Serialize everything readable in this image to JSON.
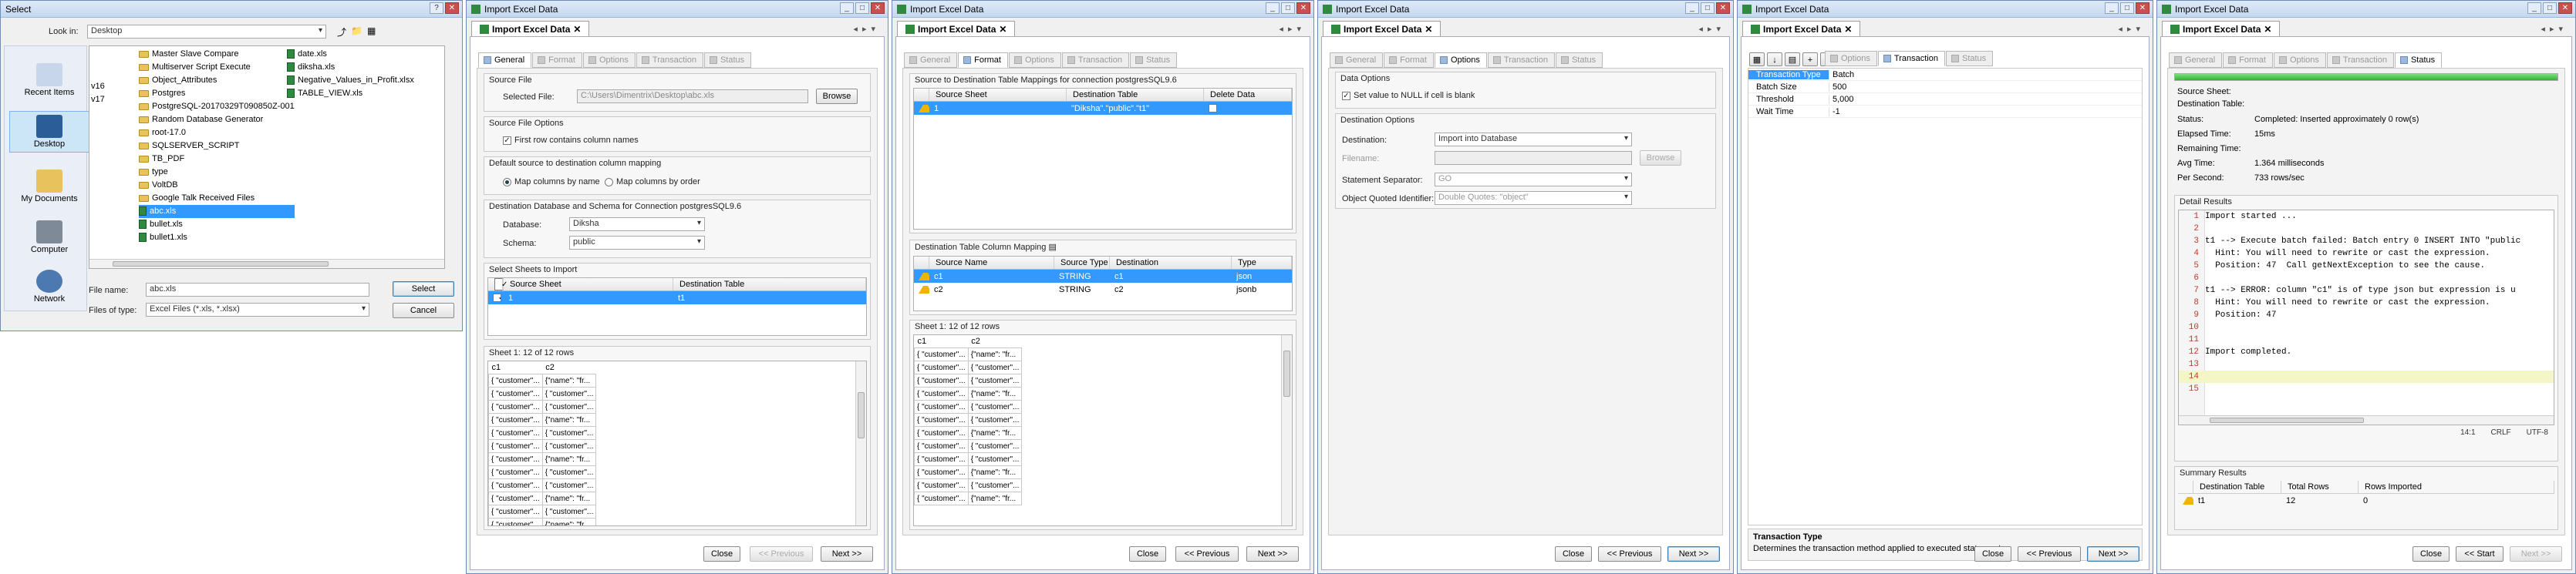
{
  "select": {
    "title": "Select",
    "look_in_label": "Look in:",
    "look_in_value": "Desktop",
    "places": [
      "Recent Items",
      "Desktop",
      "My Documents",
      "Computer",
      "Network"
    ],
    "col0": [
      "v16",
      "v17"
    ],
    "col1": [
      {
        "name": "Master Slave Compare",
        "kind": "folder"
      },
      {
        "name": "Multiserver Script Execute",
        "kind": "folder"
      },
      {
        "name": "Object_Attributes",
        "kind": "folder"
      },
      {
        "name": "Postgres",
        "kind": "folder"
      },
      {
        "name": "PostgreSQL-20170329T090850Z-001",
        "kind": "folder"
      },
      {
        "name": "Random Database Generator",
        "kind": "folder"
      },
      {
        "name": "root-17.0",
        "kind": "folder"
      },
      {
        "name": "SQLSERVER_SCRIPT",
        "kind": "folder"
      },
      {
        "name": "TB_PDF",
        "kind": "folder"
      },
      {
        "name": "type",
        "kind": "folder"
      },
      {
        "name": "VoltDB",
        "kind": "folder"
      },
      {
        "name": "Google Talk Received Files",
        "kind": "folder"
      },
      {
        "name": "abc.xls",
        "kind": "xls",
        "selected": true
      },
      {
        "name": "bullet.xls",
        "kind": "xls"
      },
      {
        "name": "bullet1.xls",
        "kind": "xls"
      }
    ],
    "col2": [
      {
        "name": "date.xls",
        "kind": "xls"
      },
      {
        "name": "diksha.xls",
        "kind": "xls"
      },
      {
        "name": "Negative_Values_in_Profit.xlsx",
        "kind": "xls"
      },
      {
        "name": "TABLE_VIEW.xls",
        "kind": "xls"
      }
    ],
    "file_name_label": "File name:",
    "file_name_value": "abc.xls",
    "files_type_label": "Files of type:",
    "files_type_value": "Excel Files (*.xls, *.xlsx)",
    "select_btn": "Select",
    "cancel_btn": "Cancel"
  },
  "common": {
    "window_title": "Import Excel Data",
    "tab_head": "Import Excel Data",
    "tabs": [
      "General",
      "Format",
      "Options",
      "Transaction",
      "Status"
    ],
    "close": "Close",
    "previous": "<< Previous",
    "next": "Next >>",
    "start": "<< Start"
  },
  "general": {
    "source_file_group": "Source File",
    "selected_file_label": "Selected File:",
    "selected_file_value": "C:\\Users\\Dimentrix\\Desktop\\abc.xls",
    "browse": "Browse",
    "source_options_group": "Source File Options",
    "first_row_label": "First row contains column names",
    "mapping_group": "Default source to destination column mapping",
    "map_by_name": "Map columns by name",
    "map_by_order": "Map columns by order",
    "dest_group": "Destination Database and Schema for Connection postgresSQL9.6",
    "database_label": "Database:",
    "database_value": "Diksha",
    "schema_label": "Schema:",
    "schema_value": "public",
    "sheets_group": "Select Sheets to Import",
    "sheets_cols": [
      "Source Sheet",
      "Destination Table"
    ],
    "sheet_row": [
      "1",
      "t1"
    ],
    "preview_title": "Sheet 1: 12 of 12 rows",
    "preview_cols": [
      "c1",
      "c2"
    ]
  },
  "format": {
    "mapping_group": "Source to Destination Table Mappings for connection postgresSQL9.6",
    "map_cols": [
      "Source Sheet",
      "Destination Table",
      "Delete Data"
    ],
    "map_row": [
      "1",
      "\"Diksha\".\"public\".\"t1\""
    ],
    "col_mapping_group": "Destination Table Column Mapping",
    "col_cols": [
      "Source Name",
      "Source Type",
      "Destination",
      "Type"
    ],
    "col_rows": [
      [
        "c1",
        "STRING",
        "c1",
        "json"
      ],
      [
        "c2",
        "STRING",
        "c2",
        "jsonb"
      ]
    ],
    "preview_title": "Sheet 1: 12 of 12 rows",
    "preview_cols": [
      "c1",
      "c2"
    ]
  },
  "options": {
    "data_options_group": "Data Options",
    "null_label": "Set value to NULL if cell is blank",
    "dest_options_group": "Destination Options",
    "destination_label": "Destination:",
    "destination_value": "Import into Database",
    "filename_label": "Filename:",
    "browse": "Browse",
    "separator_label": "Statement Separator:",
    "separator_value": "GO",
    "quoted_label": "Object Quoted Identifier:",
    "quoted_value": "Double Quotes: \"object\""
  },
  "transaction": {
    "props": [
      [
        "Transaction Type",
        "Batch"
      ],
      [
        "Batch Size",
        "500"
      ],
      [
        "Threshold",
        "5,000"
      ],
      [
        "Wait Time",
        "-1"
      ]
    ],
    "desc_title": "Transaction Type",
    "desc_text": "Determines the transaction method applied to executed statements."
  },
  "status": {
    "source_sheet_label": "Source Sheet:",
    "dest_table_label": "Destination Table:",
    "stats": [
      [
        "Status:",
        "Completed: Inserted approximately 0 row(s)"
      ],
      [
        "Elapsed Time:",
        "15ms"
      ],
      [
        "Remaining Time:",
        ""
      ],
      [
        "Avg Time:",
        "1.364 milliseconds"
      ],
      [
        "Per Second:",
        "733 rows/sec"
      ]
    ],
    "detail_group": "Detail Results",
    "lines": [
      "Import started ...",
      "",
      "t1 --> Execute batch failed: Batch entry 0 INSERT INTO \"public",
      "  Hint: You will need to rewrite or cast the expression.",
      "  Position: 47  Call getNextException to see the cause.",
      "",
      "t1 --> ERROR: column \"c1\" is of type json but expression is u",
      "  Hint: You will need to rewrite or cast the expression.",
      "  Position: 47",
      "",
      "",
      "Import completed.",
      "",
      "",
      ""
    ],
    "cursor": "14:1",
    "eol": "CRLF",
    "encoding": "UTF-8",
    "summary_group": "Summary Results",
    "summary_cols": [
      "Destination Table",
      "Total Rows",
      "Rows Imported"
    ],
    "summary_row": [
      "t1",
      "12",
      "0"
    ]
  },
  "accent": "#3399ff"
}
